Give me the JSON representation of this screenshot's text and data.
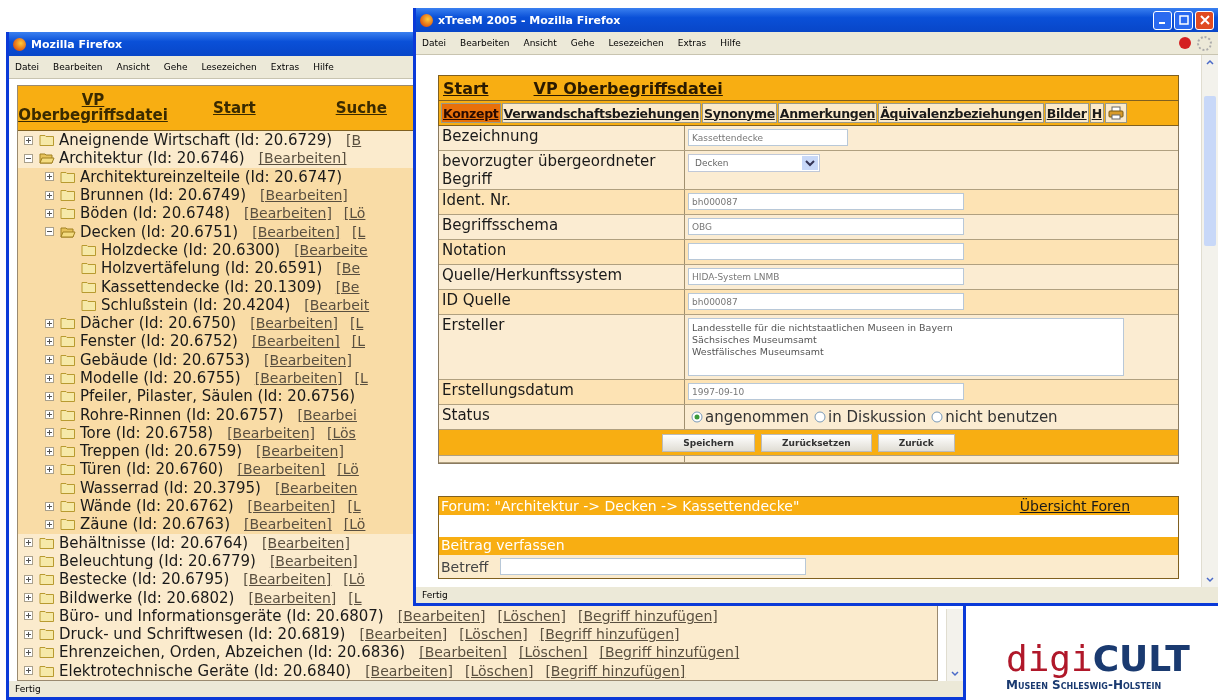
{
  "left_window": {
    "title": "Mozilla Firefox",
    "menu": [
      "Datei",
      "Bearbeiten",
      "Ansicht",
      "Gehe",
      "Lesezeichen",
      "Extras",
      "Hilfe"
    ],
    "header_links": [
      "VP Oberbegriffsdatei",
      "Start",
      "Suche"
    ],
    "tree": [
      {
        "label": "Aneignende Wirtschaft (Id: 20.6729)",
        "expanded": false,
        "links": [
          "[B"
        ]
      },
      {
        "label": "Architektur (Id: 20.6746)",
        "expanded": true,
        "links": [
          "[Bearbeiten]"
        ],
        "children": [
          {
            "label": "Architektureinzelteile (Id: 20.6747)",
            "expanded": false
          },
          {
            "label": "Brunnen (Id: 20.6749)",
            "expanded": false,
            "links": [
              "[Bearbeiten]"
            ]
          },
          {
            "label": "Böden (Id: 20.6748)",
            "expanded": false,
            "links": [
              "[Bearbeiten]",
              "[Lö"
            ]
          },
          {
            "label": "Decken (Id: 20.6751)",
            "expanded": true,
            "links": [
              "[Bearbeiten]",
              "[L"
            ],
            "children": [
              {
                "label": "Holzdecke (Id: 20.6300)",
                "links": [
                  "[Bearbeite"
                ]
              },
              {
                "label": "Holzvertäfelung (Id: 20.6591)",
                "links": [
                  "[Be"
                ]
              },
              {
                "label": "Kassettendecke (Id: 20.1309)",
                "links": [
                  "[Be"
                ]
              },
              {
                "label": "Schlußstein (Id: 20.4204)",
                "links": [
                  "[Bearbeit"
                ]
              }
            ]
          },
          {
            "label": "Dächer (Id: 20.6750)",
            "expanded": false,
            "links": [
              "[Bearbeiten]",
              "[L"
            ]
          },
          {
            "label": "Fenster (Id: 20.6752)",
            "expanded": false,
            "links": [
              "[Bearbeiten]",
              "[L"
            ]
          },
          {
            "label": "Gebäude (Id: 20.6753)",
            "expanded": false,
            "links": [
              "[Bearbeiten]"
            ]
          },
          {
            "label": "Modelle (Id: 20.6755)",
            "expanded": false,
            "links": [
              "[Bearbeiten]",
              "[L"
            ]
          },
          {
            "label": "Pfeiler, Pilaster, Säulen (Id: 20.6756)",
            "expanded": false
          },
          {
            "label": "Rohre-Rinnen (Id: 20.6757)",
            "expanded": false,
            "links": [
              "[Bearbei"
            ]
          },
          {
            "label": "Tore (Id: 20.6758)",
            "expanded": false,
            "links": [
              "[Bearbeiten]",
              "[Lös"
            ]
          },
          {
            "label": "Treppen (Id: 20.6759)",
            "expanded": false,
            "links": [
              "[Bearbeiten]"
            ]
          },
          {
            "label": "Türen (Id: 20.6760)",
            "expanded": false,
            "links": [
              "[Bearbeiten]",
              "[Lö"
            ]
          },
          {
            "label": "Wasserrad (Id: 20.3795)",
            "links": [
              "[Bearbeiten"
            ]
          },
          {
            "label": "Wände (Id: 20.6762)",
            "expanded": false,
            "links": [
              "[Bearbeiten]",
              "[L"
            ]
          },
          {
            "label": "Zäune (Id: 20.6763)",
            "expanded": false,
            "links": [
              "[Bearbeiten]",
              "[Lö"
            ]
          }
        ]
      },
      {
        "label": "Behältnisse (Id: 20.6764)",
        "expanded": false,
        "links": [
          "[Bearbeiten]"
        ]
      },
      {
        "label": "Beleuchtung (Id: 20.6779)",
        "expanded": false,
        "links": [
          "[Bearbeiten]"
        ]
      },
      {
        "label": "Bestecke (Id: 20.6795)",
        "expanded": false,
        "links": [
          "[Bearbeiten]",
          "[Lö"
        ]
      },
      {
        "label": "Bildwerke (Id: 20.6802)",
        "expanded": false,
        "links": [
          "[Bearbeiten]",
          "[L"
        ]
      },
      {
        "label": "Büro- und Informationsgeräte (Id: 20.6807)",
        "expanded": false,
        "links": [
          "[Bearbeiten]",
          "[Löschen]",
          "[Begriff hinzufügen]"
        ]
      },
      {
        "label": "Druck- und Schriftwesen (Id: 20.6819)",
        "expanded": false,
        "links": [
          "[Bearbeiten]",
          "[Löschen]",
          "[Begriff hinzufügen]"
        ]
      },
      {
        "label": "Ehrenzeichen, Orden, Abzeichen (Id: 20.6836)",
        "expanded": false,
        "links": [
          "[Bearbeiten]",
          "[Löschen]",
          "[Begriff hinzufügen]"
        ]
      },
      {
        "label": "Elektrotechnische Geräte (Id: 20.6840)",
        "expanded": false,
        "links": [
          "[Bearbeiten]",
          "[Löschen]",
          "[Begriff hinzufügen]"
        ]
      }
    ],
    "status_bar": "Fertig"
  },
  "right_window": {
    "title": "xTreeM 2005 - Mozilla Firefox",
    "menu": [
      "Datei",
      "Bearbeiten",
      "Ansicht",
      "Gehe",
      "Lesezeichen",
      "Extras",
      "Hilfe"
    ],
    "nav_links": [
      "Start",
      "VP Oberbegriffsdatei"
    ],
    "tabs": [
      {
        "label": "Konzept",
        "selected": true
      },
      {
        "label": "Verwandschaftsbeziehungen",
        "selected": false
      },
      {
        "label": "Synonyme",
        "selected": false
      },
      {
        "label": "Anmerkungen",
        "selected": false
      },
      {
        "label": "Äquivalenzbeziehungen",
        "selected": false
      },
      {
        "label": "Bilder",
        "selected": false
      },
      {
        "label": "H",
        "selected": false
      }
    ],
    "fields": [
      {
        "kind": "short_text",
        "label": "Bezeichnung",
        "value": "Kassettendecke"
      },
      {
        "kind": "select",
        "label": "bevorzugter übergeordneter Begriff",
        "value": "Decken"
      },
      {
        "kind": "text",
        "label": "Ident. Nr.",
        "value": "bh000087"
      },
      {
        "kind": "text",
        "label": "Begriffsschema",
        "value": "OBG"
      },
      {
        "kind": "text",
        "label": "Notation"
      },
      {
        "kind": "text",
        "label": "Quelle/Herkunftssystem",
        "value": "HIDA-System LNMB"
      },
      {
        "kind": "text",
        "label": "ID Quelle",
        "value": "bh000087"
      },
      {
        "kind": "textarea",
        "label": "Ersteller",
        "lines": [
          "Landesstelle für die nichtstaatlichen Museen in Bayern",
          "Sächsisches Museumsamt",
          "Westfälisches Museumsamt"
        ]
      },
      {
        "kind": "text",
        "label": "Erstellungsdatum",
        "value": "1997-09-10"
      },
      {
        "kind": "radio",
        "label": "Status",
        "options": [
          {
            "label": "angenommen",
            "selected": true
          },
          {
            "label": "in Diskussion",
            "selected": false
          },
          {
            "label": "nicht benutzen",
            "selected": false
          }
        ]
      }
    ],
    "buttons": [
      "Speichern",
      "Zurücksetzen",
      "Zurück"
    ],
    "forum": {
      "title": "Forum: \"Architektur -> Decken -> Kassettendecke\"",
      "overview_link": "Übersicht Foren",
      "compose_heading": "Beitrag verfassen",
      "subject_label": "Betreff"
    },
    "status_bar": "Fertig"
  },
  "logo": {
    "brand_light": "digi",
    "brand_bold": "CULT",
    "subtitle": "Museen Schleswig-Holstein"
  }
}
